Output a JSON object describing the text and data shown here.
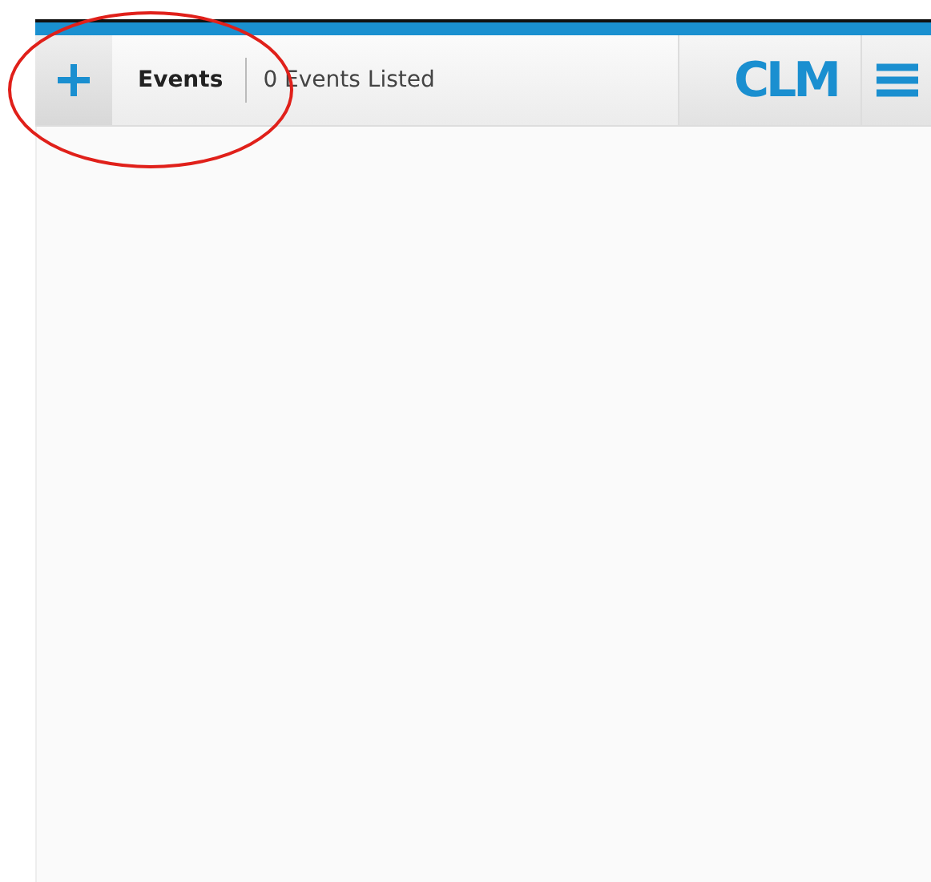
{
  "header": {
    "title": "Events",
    "count": "0 Events Listed",
    "logo": "CLM"
  },
  "annotation": {
    "kind": "ellipse"
  }
}
